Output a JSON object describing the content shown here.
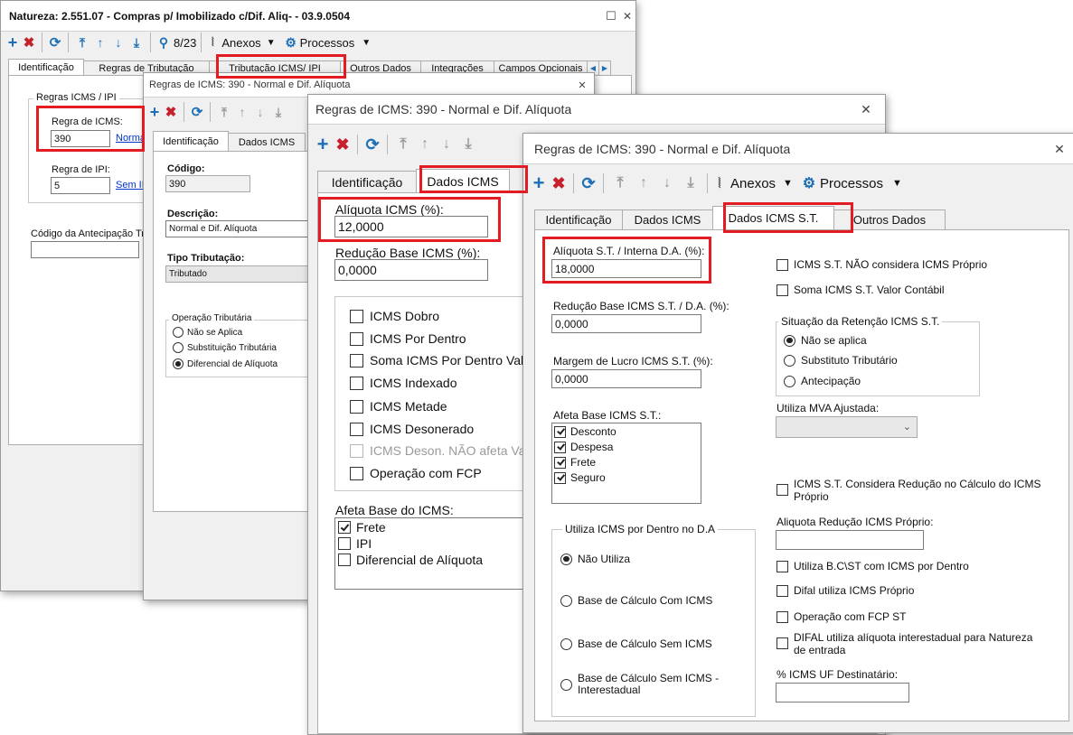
{
  "w1": {
    "title": "Natureza: 2.551.07 - Compras p/ Imobilizado c/Dif. Aliq-  - 03.9.0504",
    "restore_glyph": "☐",
    "close_glyph": "✕",
    "record_counter": "8/23",
    "anexos": "Anexos",
    "processos": "Processos",
    "tabs": [
      "Identificação",
      "Regras de Tributação",
      "Tributação ICMS/ IPI",
      "Outros Dados",
      "Integrações",
      "Campos Opcionais"
    ],
    "group_title": "Regras ICMS / IPI",
    "regra_icms_label": "Regra de ICMS:",
    "regra_icms_value": "390",
    "regra_icms_link": "Norma",
    "regra_ipi_label": "Regra de IPI:",
    "regra_ipi_value": "5",
    "regra_ipi_link": "Sem IP",
    "antecipacao_label": "Código da Antecipação Trib"
  },
  "w2": {
    "title": "Regras de ICMS: 390 - Normal e Dif. Alíquota",
    "close_glyph": "✕",
    "tabs": [
      "Identificação",
      "Dados ICMS"
    ],
    "codigo_label": "Código:",
    "codigo_value": "390",
    "descricao_label": "Descrição:",
    "descricao_value": "Normal e Dif. Alíquota",
    "tipo_label": "Tipo Tributação:",
    "tipo_value": "Tributado",
    "operacao_title": "Operação Tributária",
    "operacao_options": [
      {
        "label": "Não se Aplica",
        "checked": false
      },
      {
        "label": "Substituição Tributária",
        "checked": false
      },
      {
        "label": "Diferencial de Alíquota",
        "checked": true
      }
    ]
  },
  "w3": {
    "title": "Regras de ICMS: 390 - Normal e Dif. Alíquota",
    "close_glyph": "✕",
    "tabs": [
      "Identificação",
      "Dados ICMS"
    ],
    "aliquota_label": "Alíquota ICMS (%):",
    "aliquota_value": "12,0000",
    "reducao_label": "Redução Base ICMS (%):",
    "reducao_value": "0,0000",
    "checks": [
      {
        "label": "ICMS Dobro",
        "checked": false,
        "disabled": false
      },
      {
        "label": "ICMS Por Dentro",
        "checked": false,
        "disabled": false
      },
      {
        "label": "Soma ICMS Por Dentro Valor C",
        "checked": false,
        "disabled": false
      },
      {
        "label": "ICMS Indexado",
        "checked": false,
        "disabled": false
      },
      {
        "label": "ICMS Metade",
        "checked": false,
        "disabled": false
      },
      {
        "label": "ICMS Desonerado",
        "checked": false,
        "disabled": false
      },
      {
        "label": "ICMS Deson. NÃO afeta Valor",
        "checked": false,
        "disabled": true
      },
      {
        "label": "Operação com FCP",
        "checked": false,
        "disabled": false
      }
    ],
    "afeta_label": "Afeta Base do ICMS:",
    "afeta_items": [
      {
        "label": "Frete",
        "checked": true
      },
      {
        "label": "IPI",
        "checked": false
      },
      {
        "label": "Diferencial de Alíquota",
        "checked": false
      }
    ]
  },
  "w4": {
    "title": "Regras de ICMS: 390 - Normal e Dif. Alíquota",
    "close_glyph": "✕",
    "anexos": "Anexos",
    "processos": "Processos",
    "tabs": [
      "Identificação",
      "Dados ICMS",
      "Dados ICMS S.T.",
      "Outros Dados"
    ],
    "aliquota_st_label": "Alíquota S.T. / Interna D.A. (%):",
    "aliquota_st_value": "18,0000",
    "reducao_st_label": "Redução Base ICMS S.T. / D.A. (%):",
    "reducao_st_value": "0,0000",
    "margem_label": "Margem de Lucro ICMS S.T. (%):",
    "margem_value": "0,0000",
    "afeta_st_label": "Afeta Base ICMS S.T.:",
    "afeta_st_items": [
      {
        "label": "Desconto",
        "checked": true
      },
      {
        "label": "Despesa",
        "checked": true
      },
      {
        "label": "Frete",
        "checked": true
      },
      {
        "label": "Seguro",
        "checked": true
      }
    ],
    "utiliza_title": "Utiliza ICMS por Dentro no D.A",
    "utiliza_options": [
      {
        "label": "Não Utiliza",
        "checked": true
      },
      {
        "label": "Base de Cálculo Com ICMS",
        "checked": false
      },
      {
        "label": "Base de Cálculo Sem ICMS",
        "checked": false
      },
      {
        "label": "Base de Cálculo Sem ICMS - Interestadual",
        "checked": false
      }
    ],
    "st_nao_considera": "ICMS S.T. NÃO considera ICMS Próprio",
    "soma_st": "Soma ICMS S.T. Valor Contábil",
    "situacao_title": "Situação da Retenção ICMS S.T.",
    "situacao_options": [
      {
        "label": "Não se aplica",
        "checked": true
      },
      {
        "label": "Substituto Tributário",
        "checked": false
      },
      {
        "label": "Antecipação",
        "checked": false
      }
    ],
    "mva_label": "Utiliza MVA Ajustada:",
    "st_considera_reducao": "ICMS S.T. Considera Redução no Cálculo do ICMS Próprio",
    "aliquota_reducao_label": "Aliquota Redução ICMS Próprio:",
    "checks_bottom": [
      {
        "label": "Utiliza B.C\\ST com ICMS por Dentro",
        "checked": false
      },
      {
        "label": "Difal utiliza ICMS Próprio",
        "checked": false
      },
      {
        "label": "Operação com FCP ST",
        "checked": false
      },
      {
        "label": "DIFAL utiliza alíquota interestadual para Natureza de entrada",
        "checked": false
      }
    ],
    "uf_dest_label": "% ICMS UF Destinatário:"
  },
  "colors": {
    "highlight": "#e31c23",
    "toolbar_blue": "#1e6fb5",
    "delete_red": "#c5202b",
    "link": "#0033cc"
  }
}
